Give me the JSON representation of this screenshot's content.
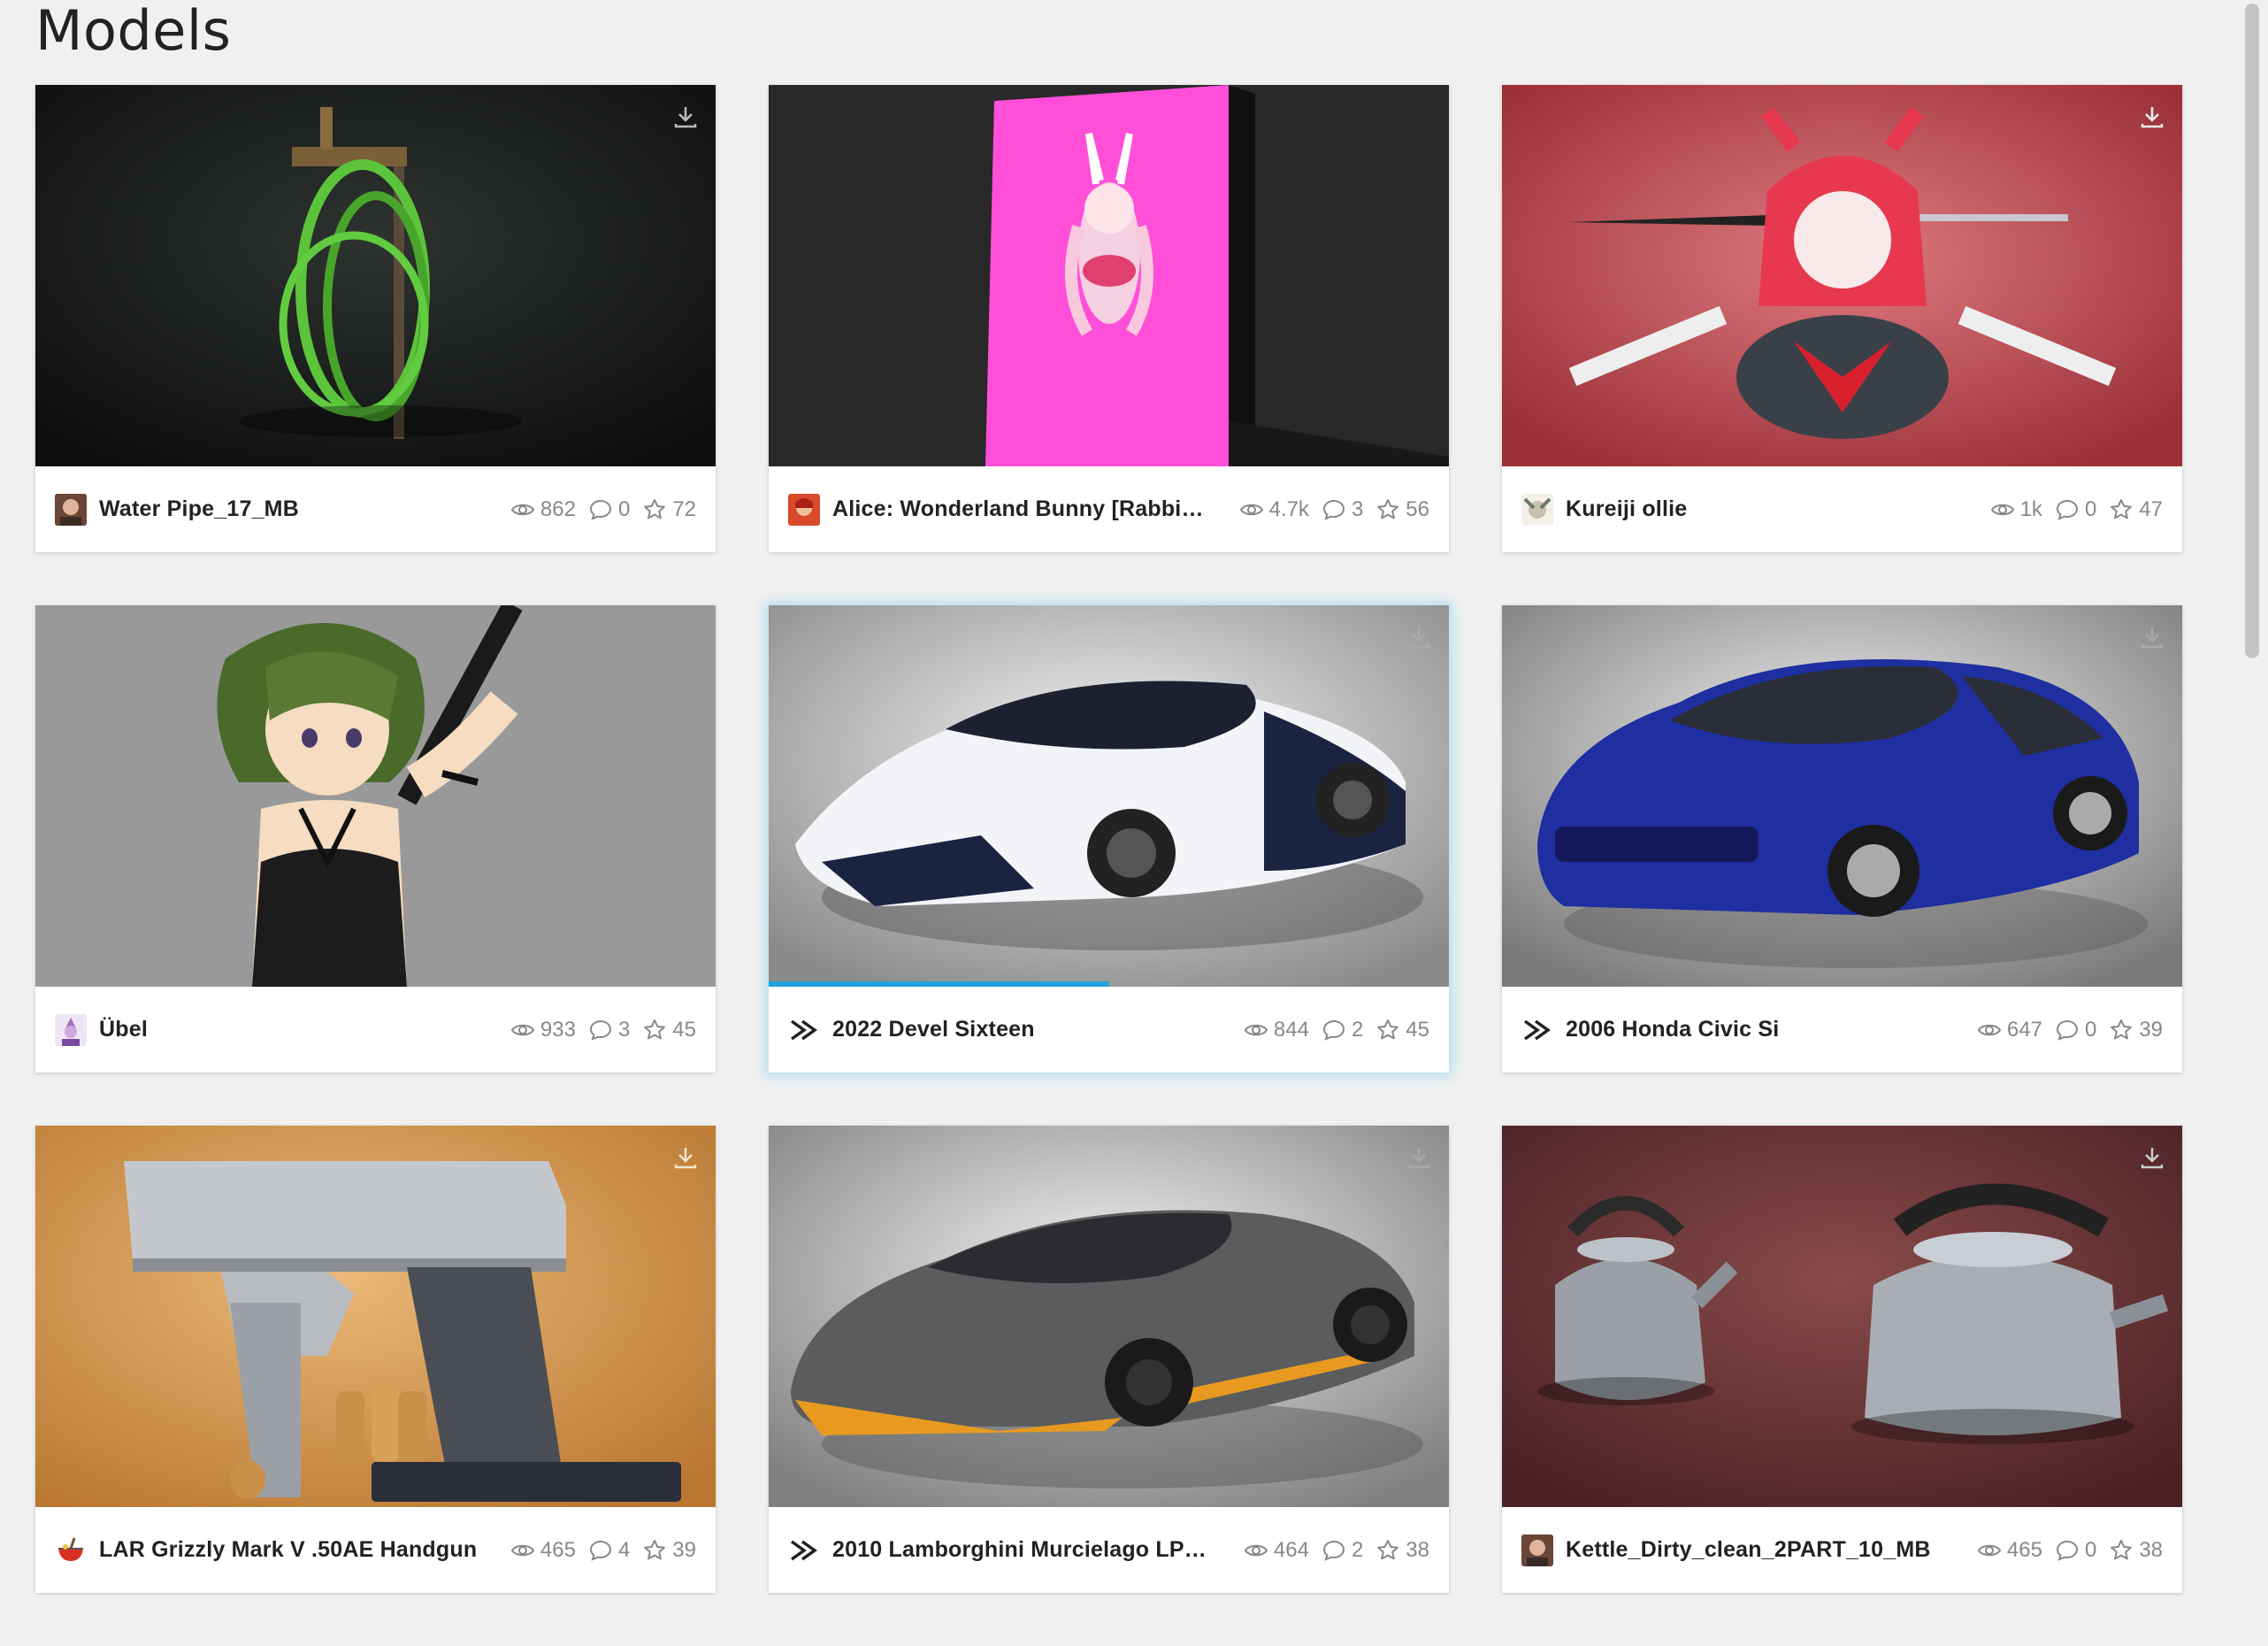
{
  "page": {
    "title": "Models"
  },
  "colors": {
    "accent": "#1fa3dc",
    "stat_gray": "#888888"
  },
  "models": [
    {
      "name": "Water Pipe_17_MB",
      "views": "862",
      "comments": "0",
      "likes": "72",
      "avatar": "user-avatar"
    },
    {
      "name": "Alice: Wonderland Bunny [Rabbit ...",
      "views": "4.7k",
      "comments": "3",
      "likes": "56",
      "avatar": "user-avatar"
    },
    {
      "name": "Kureiji ollie",
      "views": "1k",
      "comments": "0",
      "likes": "47",
      "avatar": "user-avatar"
    },
    {
      "name": "Übel",
      "views": "933",
      "comments": "3",
      "likes": "45",
      "avatar": "user-avatar"
    },
    {
      "name": "2022 Devel Sixteen",
      "views": "844",
      "comments": "2",
      "likes": "45",
      "avatar": "chevron-logo",
      "load_progress": 0.5
    },
    {
      "name": "2006 Honda Civic Si",
      "views": "647",
      "comments": "0",
      "likes": "39",
      "avatar": "chevron-logo"
    },
    {
      "name": "LAR Grizzly Mark V .50AE Handgun",
      "views": "465",
      "comments": "4",
      "likes": "39",
      "avatar": "bowl-avatar"
    },
    {
      "name": "2010 Lamborghini Murcielago LP6...",
      "views": "464",
      "comments": "2",
      "likes": "38",
      "avatar": "chevron-logo"
    },
    {
      "name": "Kettle_Dirty_clean_2PART_10_MB",
      "views": "465",
      "comments": "0",
      "likes": "38",
      "avatar": "user-avatar"
    }
  ]
}
